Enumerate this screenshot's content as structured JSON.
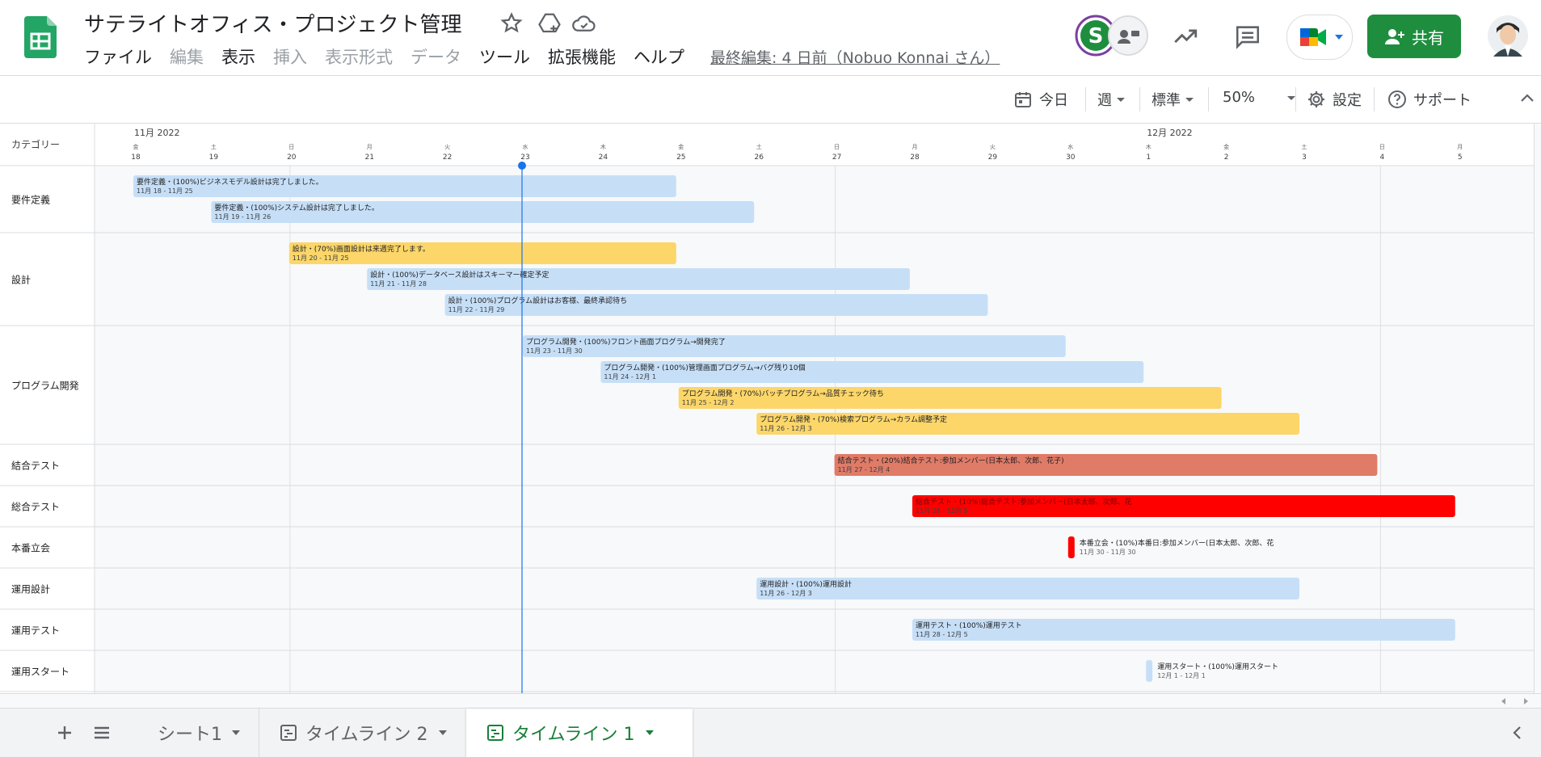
{
  "header": {
    "title": "サテライトオフィス・プロジェクト管理",
    "menu": [
      {
        "label": "ファイル",
        "enabled": true
      },
      {
        "label": "編集",
        "enabled": false
      },
      {
        "label": "表示",
        "enabled": true
      },
      {
        "label": "挿入",
        "enabled": false
      },
      {
        "label": "表示形式",
        "enabled": false
      },
      {
        "label": "データ",
        "enabled": false
      },
      {
        "label": "ツール",
        "enabled": true
      },
      {
        "label": "拡張機能",
        "enabled": true
      },
      {
        "label": "ヘルプ",
        "enabled": true
      }
    ],
    "last_edit": "最終編集: 4 日前（Nobuo Konnai さん）",
    "share_label": "共有",
    "brand_color": "#1e8e3e"
  },
  "toolbar": {
    "today": "今日",
    "range": "週",
    "density": "標準",
    "zoom": "50%",
    "settings": "設定",
    "support": "サポート"
  },
  "timeline": {
    "category_header": "カテゴリー",
    "months": [
      {
        "label": "11月 2022",
        "day_index": 0
      },
      {
        "label": "12月 2022",
        "day_index": 13
      }
    ],
    "days": [
      {
        "dow": "金",
        "num": "18"
      },
      {
        "dow": "土",
        "num": "19"
      },
      {
        "dow": "日",
        "num": "20"
      },
      {
        "dow": "月",
        "num": "21"
      },
      {
        "dow": "火",
        "num": "22"
      },
      {
        "dow": "水",
        "num": "23"
      },
      {
        "dow": "木",
        "num": "24"
      },
      {
        "dow": "金",
        "num": "25"
      },
      {
        "dow": "土",
        "num": "26"
      },
      {
        "dow": "日",
        "num": "27"
      },
      {
        "dow": "月",
        "num": "28"
      },
      {
        "dow": "火",
        "num": "29"
      },
      {
        "dow": "水",
        "num": "30"
      },
      {
        "dow": "木",
        "num": "1"
      },
      {
        "dow": "金",
        "num": "2"
      },
      {
        "dow": "土",
        "num": "3"
      },
      {
        "dow": "日",
        "num": "4"
      },
      {
        "dow": "月",
        "num": "5"
      }
    ],
    "today_index": 5,
    "categories": [
      {
        "name": "要件定義",
        "tasks": [
          {
            "title": "要件定義・(100%)ビジネスモデル設計は完了しました。",
            "dates": "11月 18 - 11月 25",
            "start": 0,
            "end": 7,
            "color": "#c6dff7"
          },
          {
            "title": "要件定義・(100%)システム設計は完了しました。",
            "dates": "11月 19 - 11月 26",
            "start": 1,
            "end": 8,
            "color": "#c6dff7"
          }
        ]
      },
      {
        "name": "設計",
        "tasks": [
          {
            "title": "設計・(70%)画面設計は来週完了します。",
            "dates": "11月 20 - 11月 25",
            "start": 2,
            "end": 7,
            "color": "#fcd669"
          },
          {
            "title": "設計・(100%)データベース設計はスキーマー確定予定",
            "dates": "11月 21 - 11月 28",
            "start": 3,
            "end": 10,
            "color": "#c6dff7"
          },
          {
            "title": "設計・(100%)プログラム設計はお客様、最終承認待ち",
            "dates": "11月 22 - 11月 29",
            "start": 4,
            "end": 11,
            "color": "#c6dff7"
          }
        ]
      },
      {
        "name": "プログラム開発",
        "tasks": [
          {
            "title": "プログラム開発・(100%)フロント画面プログラム→開発完了",
            "dates": "11月 23 - 11月 30",
            "start": 5,
            "end": 12,
            "color": "#c6dff7"
          },
          {
            "title": "プログラム開発・(100%)管理画面プログラム→バグ残り10個",
            "dates": "11月 24 - 12月 1",
            "start": 6,
            "end": 13,
            "color": "#c6dff7"
          },
          {
            "title": "プログラム開発・(70%)バッチプログラム→品質チェック待ち",
            "dates": "11月 25 - 12月 2",
            "start": 7,
            "end": 14,
            "color": "#fcd669"
          },
          {
            "title": "プログラム開発・(70%)検索プログラム→カラム調整予定",
            "dates": "11月 26 - 12月 3",
            "start": 8,
            "end": 15,
            "color": "#fcd669"
          }
        ]
      },
      {
        "name": "結合テスト",
        "tasks": [
          {
            "title": "結合テスト・(20%)結合テスト:参加メンバー(日本太郎、次郎、花子)",
            "dates": "11月 27 - 12月 4",
            "start": 9,
            "end": 16,
            "color": "#e07b67"
          }
        ]
      },
      {
        "name": "総合テスト",
        "tasks": [
          {
            "title": "総合テスト・(10%)総合テスト:参加メンバー(日本太郎、次郎、花",
            "dates": "11月 28 - 12月 5",
            "start": 10,
            "end": 17,
            "color": "#ff0000"
          }
        ]
      },
      {
        "name": "本番立会",
        "tasks": [
          {
            "title": "本番立会・(10%)本番日:参加メンバー(日本太郎、次郎、花",
            "dates": "11月 30 - 11月 30",
            "start": 12,
            "end": 12.1,
            "color": "#ff0000",
            "label_outside": true
          }
        ]
      },
      {
        "name": "運用設計",
        "tasks": [
          {
            "title": "運用設計・(100%)運用設計",
            "dates": "11月 26 - 12月 3",
            "start": 8,
            "end": 15,
            "color": "#c6dff7"
          }
        ]
      },
      {
        "name": "運用テスト",
        "tasks": [
          {
            "title": "運用テスト・(100%)運用テスト",
            "dates": "11月 28 - 12月 5",
            "start": 10,
            "end": 17,
            "color": "#c6dff7"
          }
        ]
      },
      {
        "name": "運用スタート",
        "tasks": [
          {
            "title": "運用スタート・(100%)運用スタート",
            "dates": "12月 1 - 12月 1",
            "start": 13,
            "end": 13.1,
            "color": "#c6dff7",
            "label_outside": true
          }
        ]
      }
    ]
  },
  "sheets": [
    {
      "label": "シート1",
      "icon": "none",
      "active": false
    },
    {
      "label": "タイムライン 2",
      "icon": "timeline-icon",
      "active": false
    },
    {
      "label": "タイムライン 1",
      "icon": "timeline-icon",
      "active": true
    }
  ],
  "accent_color": "#188038",
  "today_line_color": "#1a73e8"
}
